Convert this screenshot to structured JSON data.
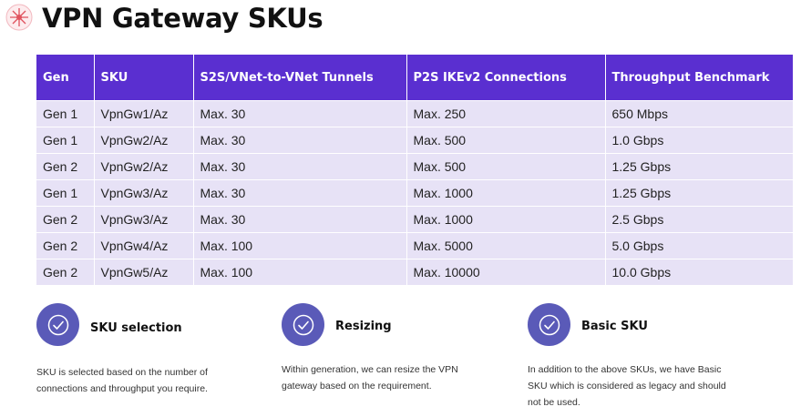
{
  "page": {
    "title": "VPN Gateway SKUs",
    "logo_icon": "azure-vpn-logo-icon",
    "accent_color": "#5a2fd0",
    "row_color": "#e7e2f6",
    "badge_color": "#5a5ab8"
  },
  "table": {
    "headers": [
      "Gen",
      "SKU",
      "S2S/VNet-to-VNet Tunnels",
      "P2S IKEv2 Connections",
      "Throughput Benchmark"
    ],
    "rows": [
      [
        "Gen 1",
        "VpnGw1/Az",
        "Max. 30",
        "Max. 250",
        "650 Mbps"
      ],
      [
        "Gen 1",
        "VpnGw2/Az",
        "Max. 30",
        "Max. 500",
        "1.0 Gbps"
      ],
      [
        "Gen 2",
        "VpnGw2/Az",
        "Max. 30",
        "Max. 500",
        "1.25 Gbps"
      ],
      [
        "Gen 1",
        "VpnGw3/Az",
        "Max. 30",
        "Max. 1000",
        "1.25 Gbps"
      ],
      [
        "Gen 2",
        "VpnGw3/Az",
        "Max. 30",
        "Max. 1000",
        "2.5 Gbps"
      ],
      [
        "Gen 2",
        "VpnGw4/Az",
        "Max. 100",
        "Max. 5000",
        "5.0 Gbps"
      ],
      [
        "Gen 2",
        "VpnGw5/Az",
        "Max. 100",
        "Max. 10000",
        "10.0 Gbps"
      ]
    ]
  },
  "cards": [
    {
      "icon": "check-circle-icon",
      "heading": "SKU selection",
      "text": "SKU is selected based on the number of connections and throughput you require."
    },
    {
      "icon": "check-circle-icon",
      "heading": "Resizing",
      "text": "Within generation, we can resize the VPN gateway based on the requirement."
    },
    {
      "icon": "check-circle-icon",
      "heading": "Basic SKU",
      "text": "In addition to the above SKUs, we have Basic SKU which is considered as legacy and should not be used."
    }
  ]
}
